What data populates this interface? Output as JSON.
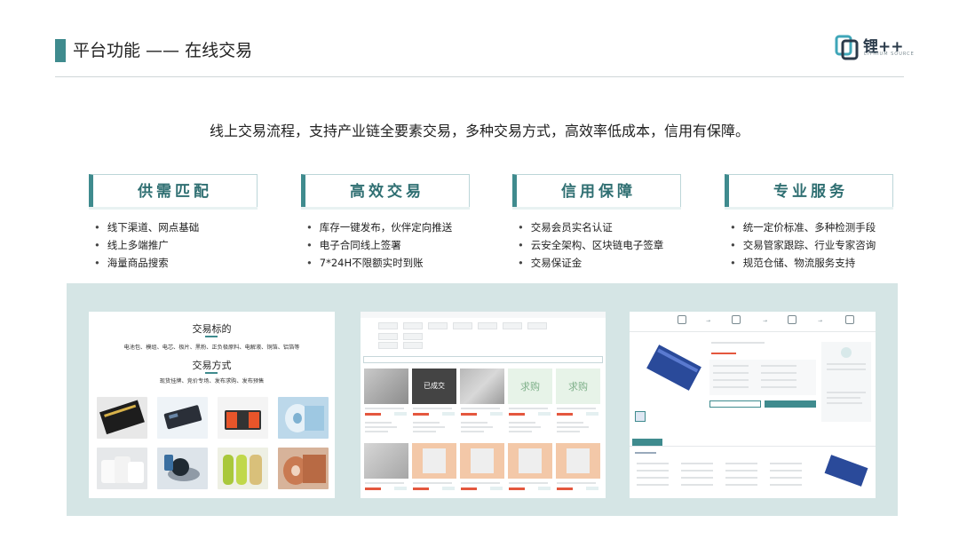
{
  "header": {
    "title": "平台功能 —— 在线交易",
    "logo_name": "锂++",
    "logo_sub": "LITHIUM SOURCE"
  },
  "subtitle": "线上交易流程，支持产业链全要素交易，多种交易方式，高效率低成本，信用有保障。",
  "features": [
    {
      "title": "供需匹配",
      "items": [
        "线下渠道、网点基础",
        "线上多端推广",
        "海量商品搜索"
      ]
    },
    {
      "title": "高效交易",
      "items": [
        "库存一键发布，伙伴定向推送",
        "电子合同线上签署",
        "7*24H不限额实时到账"
      ]
    },
    {
      "title": "信用保障",
      "items": [
        "交易会员实名认证",
        "云安全架构、区块链电子签章",
        "交易保证金"
      ]
    },
    {
      "title": "专业服务",
      "items": [
        "统一定价标准、多种检测手段",
        "交易管家跟踪、行业专家咨询",
        "规范仓储、物流服务支持"
      ]
    }
  ],
  "screenshot1": {
    "heading1": "交易标的",
    "targets": "电池包、模组、电芯、极片、黑粉、正负极原料、电解液、铜箔、铝箔等",
    "heading2": "交易方式",
    "methods": "现货挂牌、竞价专场、发布求购、发布预售"
  },
  "screenshot2": {
    "overlay_sold": "已成交",
    "want_buy": "求购"
  },
  "colors": {
    "accent": "#3f8b8e",
    "panel_bg": "#d5e5e5",
    "price_red": "#e4573e"
  }
}
